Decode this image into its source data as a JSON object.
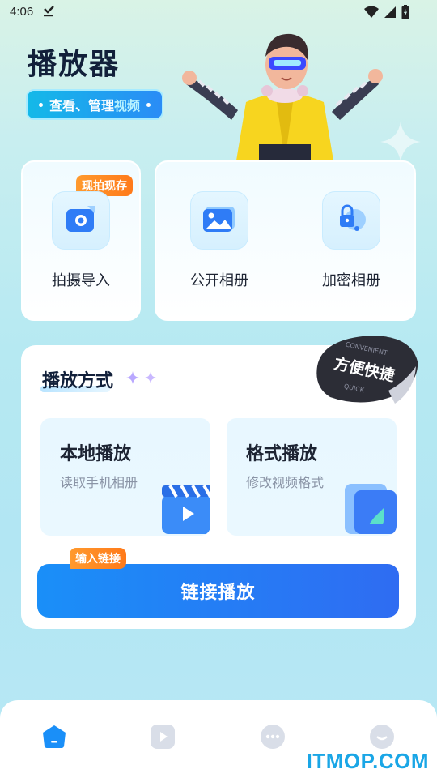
{
  "status_bar": {
    "time": "4:06",
    "icons": [
      "download-check-icon",
      "wifi-icon",
      "signal-icon",
      "battery-icon"
    ]
  },
  "header": {
    "title": "播放器",
    "subtitle_part1": "查看、管理",
    "subtitle_part2": "视频"
  },
  "import_card": {
    "badge": "现拍现存",
    "label": "拍摄导入",
    "icon": "camera-import-icon"
  },
  "album_cards": [
    {
      "label": "公开相册",
      "icon": "photo-album-icon"
    },
    {
      "label": "加密相册",
      "icon": "lock-album-icon"
    }
  ],
  "play_section": {
    "title": "播放方式",
    "sticker": {
      "text": "方便快捷",
      "text_small_top": "CONVENIENT",
      "text_small_bottom": "QUICK"
    },
    "modes": [
      {
        "title": "本地播放",
        "desc": "读取手机相册",
        "icon": "video-clapper-icon"
      },
      {
        "title": "格式播放",
        "desc": "修改视频格式",
        "icon": "format-file-icon"
      }
    ],
    "link_button": {
      "label": "链接播放",
      "badge": "输入链接"
    }
  },
  "bottom_nav": {
    "items": [
      {
        "icon": "home-icon",
        "active": true
      },
      {
        "icon": "play-icon",
        "active": false
      },
      {
        "icon": "more-icon",
        "active": false
      },
      {
        "icon": "profile-icon",
        "active": false
      }
    ]
  },
  "watermark": "ITMOP.COM",
  "colors": {
    "accent_blue": "#1a8ff8",
    "badge_orange": "#ff8a24",
    "title_dark": "#12203a"
  }
}
